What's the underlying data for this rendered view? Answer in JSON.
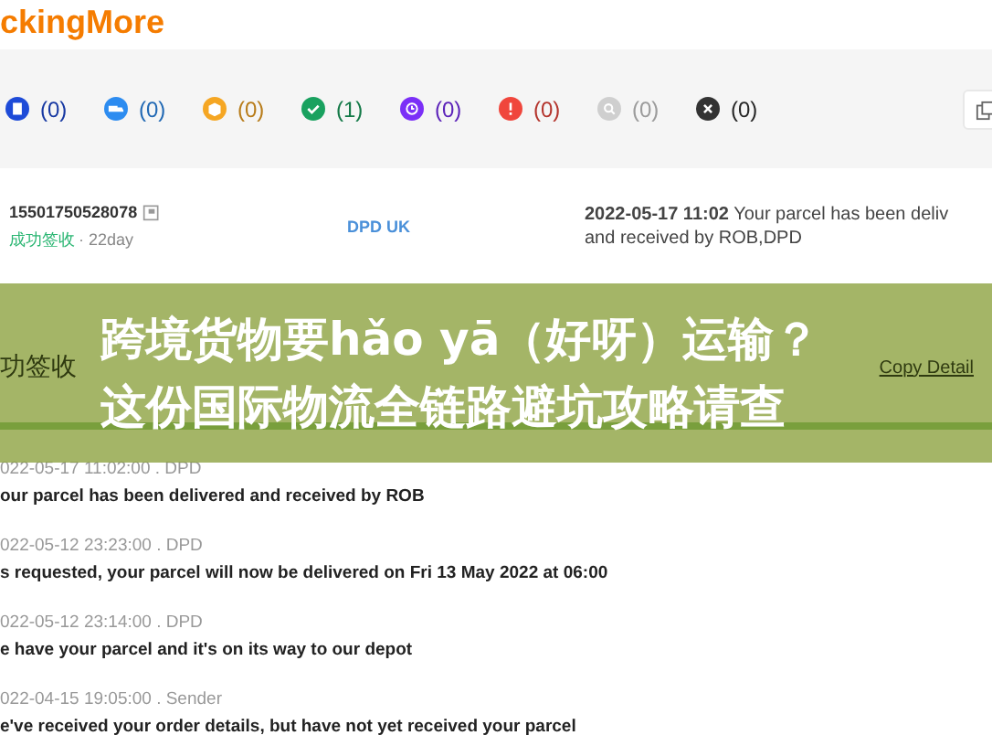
{
  "header": {
    "logo": "ckingMore"
  },
  "filters": [
    {
      "kind": "doc",
      "count": "(0)",
      "color": "#1e4bd8"
    },
    {
      "kind": "truck",
      "count": "(0)",
      "color": "#2d8cf0"
    },
    {
      "kind": "box",
      "count": "(0)",
      "color": "#f5a623"
    },
    {
      "kind": "check",
      "count": "(1)",
      "color": "#19a15f"
    },
    {
      "kind": "clock",
      "count": "(0)",
      "color": "#7b2ff7"
    },
    {
      "kind": "alert",
      "count": "(0)",
      "color": "#f0463c"
    },
    {
      "kind": "search",
      "count": "(0)",
      "color": "#cfcfcf"
    },
    {
      "kind": "close",
      "count": "(0)",
      "color": "#333333"
    }
  ],
  "shipment": {
    "number": "15501750528078",
    "status": "成功签收",
    "age": "· 22day",
    "carrier": "DPD UK",
    "latest_time": "2022-05-17 11:02",
    "latest_text": "Your parcel has been deliv",
    "latest_text_2": "and received by ROB,DPD"
  },
  "detail": {
    "status": "功签收",
    "copy": "Copy Detail"
  },
  "events": [
    {
      "time": "022-05-17 11:02:00 . DPD",
      "text": "our parcel has been delivered and received by ROB"
    },
    {
      "time": "022-05-12 23:23:00 . DPD",
      "text": "s requested, your parcel will now be delivered on Fri 13 May 2022 at 06:00"
    },
    {
      "time": "022-05-12 23:14:00 . DPD",
      "text": "e have your parcel and it's on its way to our depot"
    },
    {
      "time": "022-04-15 19:05:00 . Sender",
      "text": "e've received your order details, but have not yet received your parcel"
    }
  ],
  "banner": {
    "lines": [
      "跨境货物要hǎo yā（好呀）运输？",
      "这份国际物流全链路避坑攻略请查"
    ]
  }
}
